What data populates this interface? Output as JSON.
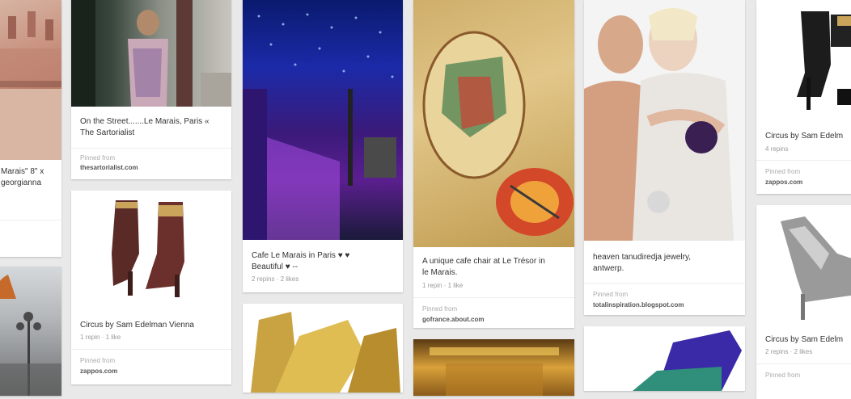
{
  "pins": {
    "c0a": {
      "desc": "Marais\" 8\" x\ngeorgianna"
    },
    "c1a": {
      "desc": "On the Street.......Le Marais, Paris «\nThe Sartorialist",
      "pinned_from": "Pinned from",
      "source": "thesartorialist.com"
    },
    "c1b": {
      "desc": "Circus by Sam Edelman Vienna",
      "meta": "1 repin · 1 like",
      "pinned_from": "Pinned from",
      "source": "zappos.com"
    },
    "c2a": {
      "desc": "Cafe Le Marais in Paris ♥ ♥\nBeautiful ♥ --",
      "meta": "2 repins · 2 likes"
    },
    "c3a": {
      "desc": "A unique cafe chair at Le Trésor in\nle Marais.",
      "meta": "1 repin · 1 like",
      "pinned_from": "Pinned from",
      "source": "gofrance.about.com"
    },
    "c4a": {
      "desc": "heaven tanudiredja jewelry,\nantwerp.",
      "pinned_from": "Pinned from",
      "source": "totalinspiration.blogspot.com"
    },
    "c5a": {
      "desc": "Circus by Sam Edelm",
      "meta": "4 repins",
      "pinned_from": "Pinned from",
      "source": "zappos.com"
    },
    "c5b": {
      "desc": "Circus by Sam Edelm",
      "meta": "2 repins · 2 likes",
      "pinned_from": "Pinned from"
    }
  },
  "colors": {
    "background": "#e9e9e9",
    "card": "#ffffff"
  }
}
